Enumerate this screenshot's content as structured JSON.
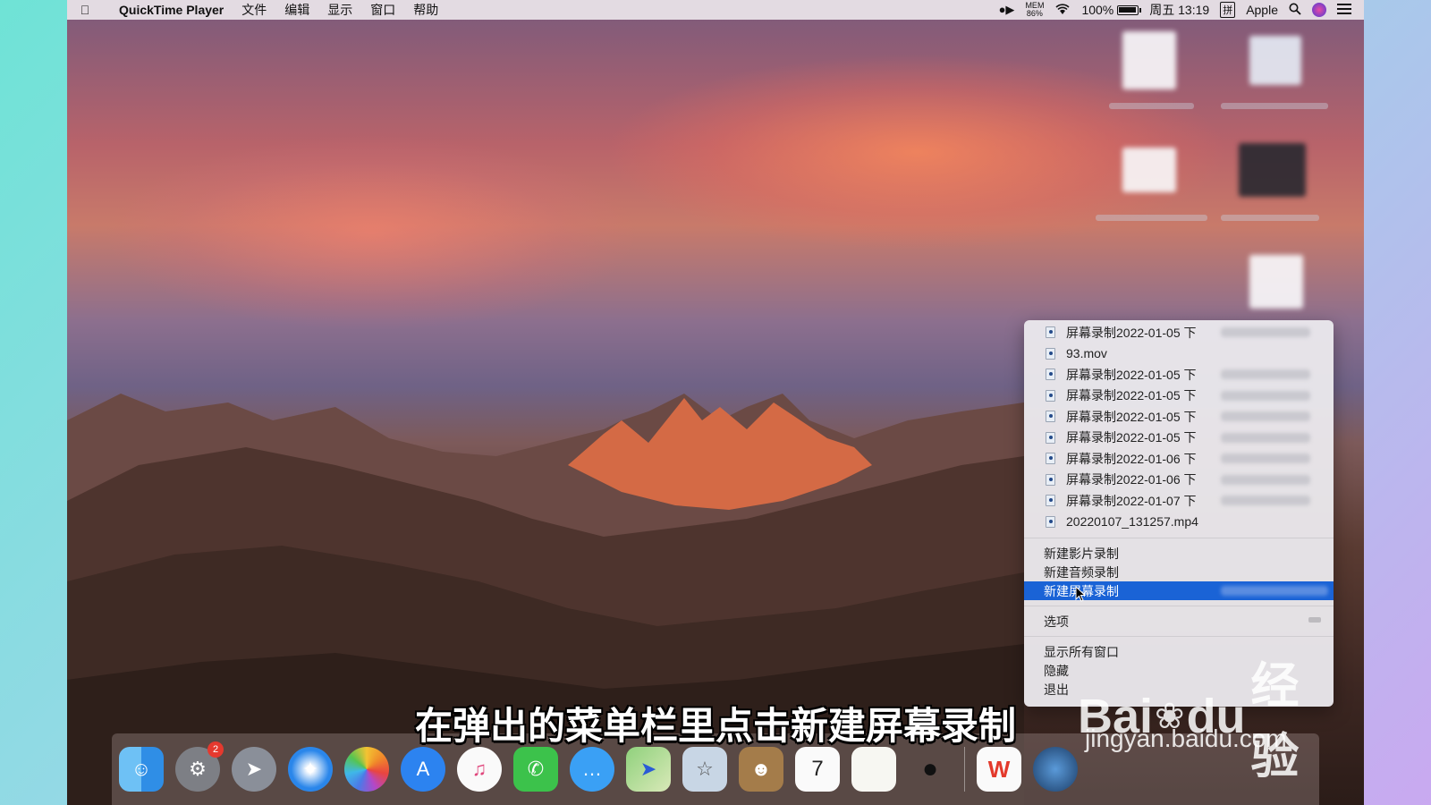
{
  "menubar": {
    "apple_icon": "apple-logo",
    "app_name": "QuickTime Player",
    "menus": [
      "文件",
      "编辑",
      "显示",
      "窗口",
      "帮助"
    ],
    "mem_label": "MEM",
    "mem_value": "86%",
    "battery_percent": "100%",
    "battery_level": 1.0,
    "datetime": "周五 13:19",
    "input_method": "拼",
    "user": "Apple"
  },
  "context_menu": {
    "recent_files": [
      "屏幕录制2022-01-05 下",
      "93.mov",
      "屏幕录制2022-01-05 下",
      "屏幕录制2022-01-05 下",
      "屏幕录制2022-01-05 下",
      "屏幕录制2022-01-05 下",
      "屏幕录制2022-01-06 下",
      "屏幕录制2022-01-06 下",
      "屏幕录制2022-01-07 下",
      "20220107_131257.mp4"
    ],
    "new_movie_recording": "新建影片录制",
    "new_audio_recording": "新建音频录制",
    "new_screen_recording": "新建屏幕录制",
    "options": "选项",
    "show_all_windows": "显示所有窗口",
    "hide": "隐藏",
    "quit": "退出",
    "selected_item": "新建屏幕录制"
  },
  "subtitle": "在弹出的菜单栏里点击新建屏幕录制",
  "watermark": {
    "brand_part1": "Bai",
    "brand_part2": "du",
    "brand_cn": "经验",
    "url": "jingyan.baidu.com"
  },
  "dock": {
    "system_prefs_badge": "2",
    "calendar_day": "7",
    "apps": [
      "finder",
      "system-preferences",
      "launchpad",
      "safari",
      "photos",
      "app-store",
      "itunes",
      "facetime",
      "messages",
      "maps",
      "preview",
      "contacts",
      "calendar",
      "textedit",
      "qq",
      "wps",
      "quicktime"
    ]
  },
  "colors": {
    "menu_highlight": "#1a63d6",
    "menubar_bg": "#ece6ea"
  }
}
